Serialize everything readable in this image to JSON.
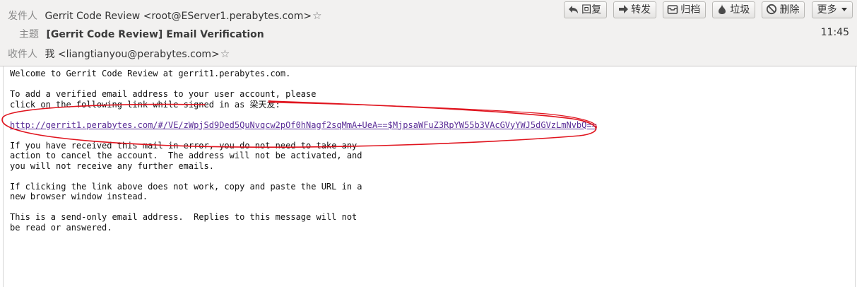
{
  "header": {
    "from_label": "发件人",
    "from_value": "Gerrit Code Review <root@EServer1.perabytes.com>",
    "subject_label": "主题",
    "subject_value": "[Gerrit Code Review] Email Verification",
    "to_label": "收件人",
    "to_value": "我 <liangtianyou@perabytes.com>",
    "time": "11:45",
    "star_glyph": "☆"
  },
  "toolbar": {
    "reply": "回复",
    "forward": "转发",
    "archive": "归档",
    "junk": "垃圾",
    "delete": "删除",
    "more": "更多"
  },
  "message": {
    "line1": "Welcome to Gerrit Code Review at gerrit1.perabytes.com.",
    "para2": "To add a verified email address to your user account, please\nclick on the following link while signed in as 梁天友:",
    "link": "http://gerrit1.perabytes.com/#/VE/zWpjSd9Ded5QuNvqcw2pOf0hNagf2sqMmA+UeA==$MjpsaWFuZ3RpYW55b3VAcGVyYWJ5dGVzLmNvbQ==",
    "para3": "If you have received this mail in error, you do not need to take any\naction to cancel the account.  The address will not be activated, and\nyou will not receive any further emails.",
    "para4": "If clicking the link above does not work, copy and paste the URL in a\nnew browser window instead.",
    "para5": "This is a send-only email address.  Replies to this message will not\nbe read or answered."
  },
  "colors": {
    "annotation": "#e0141e",
    "link": "#5a2d97",
    "header_bg": "#f2f1f0"
  },
  "icons": [
    "reply-icon",
    "forward-icon",
    "archive-icon",
    "junk-icon",
    "delete-icon",
    "dropdown-caret-icon",
    "star-icon"
  ]
}
